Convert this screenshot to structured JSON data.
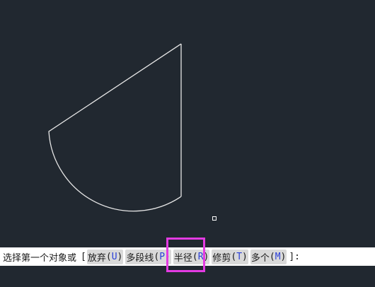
{
  "canvas": {
    "background": "#212830",
    "line_color": "#e6e6e6"
  },
  "command_line": {
    "prompt": "选择第一个对象或",
    "open_bracket": "[",
    "close_bracket": "]:",
    "options": [
      {
        "label": "放弃",
        "key": "U"
      },
      {
        "label": "多段线",
        "key": "P"
      },
      {
        "label": "半径",
        "key": "R"
      },
      {
        "label": "修剪",
        "key": "T"
      },
      {
        "label": "多个",
        "key": "M"
      }
    ]
  },
  "colors": {
    "option_key": "#2a3fd8",
    "highlight": "#e33be2",
    "option_bg": "#d9d9d9"
  }
}
